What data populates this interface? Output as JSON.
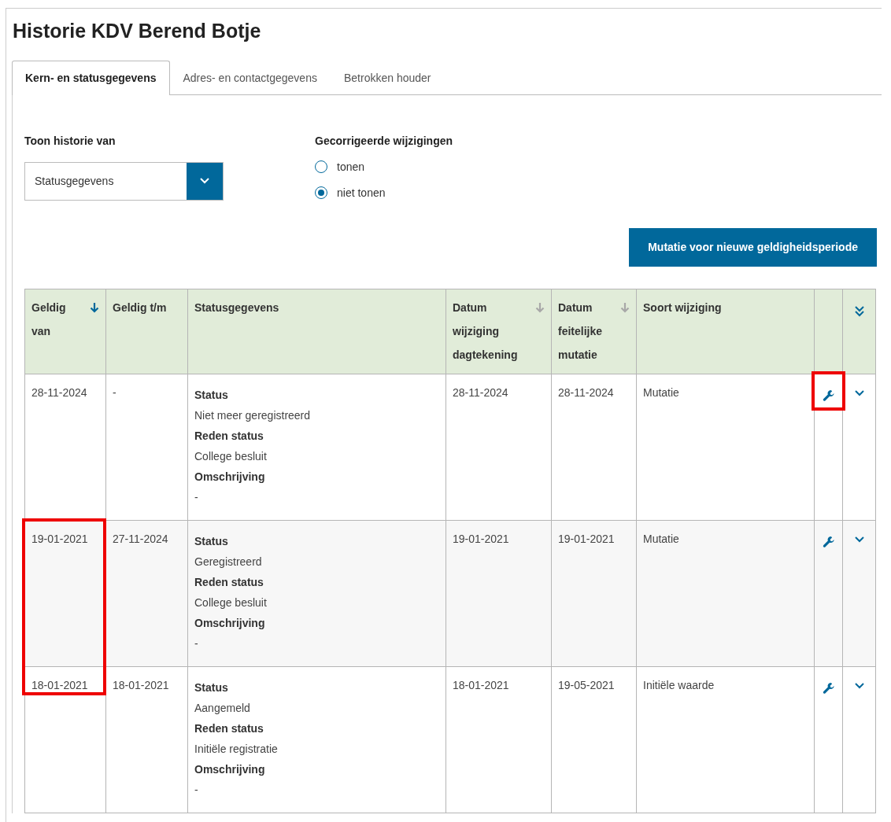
{
  "title": "Historie KDV Berend Botje",
  "tabs": [
    {
      "label": "Kern- en statusgegevens",
      "selected": true
    },
    {
      "label": "Adres- en contactgegevens",
      "selected": false
    },
    {
      "label": "Betrokken houder",
      "selected": false
    }
  ],
  "filter": {
    "label": "Toon historie van",
    "value": "Statusgegevens"
  },
  "corrections": {
    "label": "Gecorrigeerde wijzigingen",
    "options": [
      {
        "label": "tonen",
        "selected": false
      },
      {
        "label": "niet tonen",
        "selected": true
      }
    ]
  },
  "action_button": "Mutatie voor nieuwe geldigheidsperiode",
  "table": {
    "columns": [
      {
        "label": "Geldig van",
        "kind": "text",
        "sort_active": true
      },
      {
        "label": "Geldig t/m",
        "kind": "text"
      },
      {
        "label": "Statusgegevens",
        "kind": "text"
      },
      {
        "label": "Datum wijziging dagtekening",
        "kind": "text",
        "sort_active": false
      },
      {
        "label": "Datum feitelijke mutatie",
        "kind": "text",
        "sort_active": false
      },
      {
        "label": "Soort wijziging",
        "kind": "text"
      },
      {
        "kind": "edit"
      },
      {
        "kind": "expand-all"
      }
    ],
    "rows": [
      {
        "geldig_van": "28-11-2024",
        "geldig_tm": "-",
        "fields": [
          {
            "label": "Status",
            "value": "Niet meer geregistreerd"
          },
          {
            "label": "Reden status",
            "value": "College besluit"
          },
          {
            "label": "Omschrijving",
            "value": "-"
          }
        ],
        "datum_wijziging": "28-11-2024",
        "datum_mutatie": "28-11-2024",
        "soort": "Mutatie",
        "highlight_geldig_van": false,
        "highlight_edit": true
      },
      {
        "geldig_van": "19-01-2021",
        "geldig_tm": "27-11-2024",
        "fields": [
          {
            "label": "Status",
            "value": "Geregistreerd"
          },
          {
            "label": "Reden status",
            "value": "College besluit"
          },
          {
            "label": "Omschrijving",
            "value": "-"
          }
        ],
        "datum_wijziging": "19-01-2021",
        "datum_mutatie": "19-01-2021",
        "soort": "Mutatie",
        "highlight_geldig_van": true,
        "highlight_edit": false
      },
      {
        "geldig_van": "18-01-2021",
        "geldig_tm": "18-01-2021",
        "fields": [
          {
            "label": "Status",
            "value": "Aangemeld"
          },
          {
            "label": "Reden status",
            "value": "Initiële registratie"
          },
          {
            "label": "Omschrijving",
            "value": "-"
          }
        ],
        "datum_wijziging": "18-01-2021",
        "datum_mutatie": "19-05-2021",
        "soort": "Initiële waarde",
        "highlight_geldig_van": true,
        "highlight_edit": false
      }
    ]
  }
}
